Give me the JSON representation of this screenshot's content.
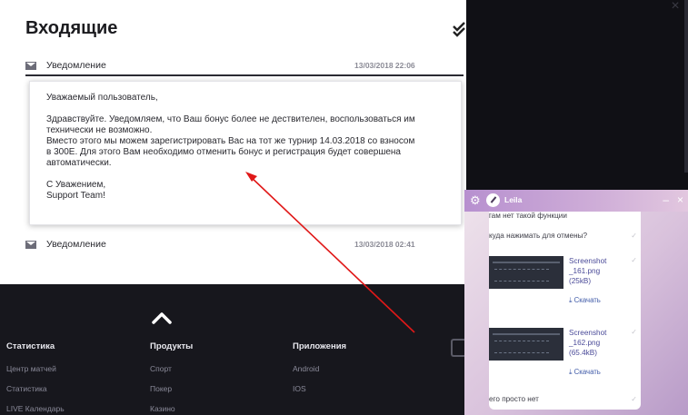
{
  "inbox": {
    "title": "Входящие",
    "mark_all_icon": "double-check-icon",
    "notifications": [
      {
        "label": "Уведомление",
        "date": "13/03/2018 22:06"
      },
      {
        "label": "Уведомление",
        "date": "13/03/2018 02:41"
      }
    ],
    "message": {
      "greeting": "Уважаемый пользователь,",
      "line1": "Здравствуйте. Уведомляем, что Ваш бонус более не дествителен, воспользоваться им",
      "line2": "технически не возможно.",
      "line3": "Вместо этого мы можем зарегистрировать Вас на тот же турнир 14.03.2018 со взносом",
      "line4": "в 300Е. Для этого Вам необходимо отменить бонус и регистрация будет совершена",
      "line5": "автоматически.",
      "signoff1": "С Уважением,",
      "signoff2": "Support Team!"
    }
  },
  "footer": {
    "scroll_top_icon": "chevron-up-icon",
    "columns": [
      {
        "head": "Статистика",
        "links": [
          "Центр матчей",
          "Статистика",
          "LIVE Календарь"
        ]
      },
      {
        "head": "Продукты",
        "links": [
          "Спорт",
          "Покер",
          "Казино"
        ]
      },
      {
        "head": "Приложения",
        "links": [
          "Android",
          "IOS"
        ]
      }
    ],
    "social_icon": "instagram-icon"
  },
  "overlay": {
    "close_label": "×"
  },
  "chat": {
    "agent_name": "Leila",
    "minimize_label": "–",
    "close_label": "×",
    "messages": [
      "там нет такой функции",
      "куда нажимать для отмены?"
    ],
    "attachments": [
      {
        "name_line1": "Screenshot",
        "name_line2": "_161.png",
        "size": "(25kB)",
        "download": "Скачать"
      },
      {
        "name_line1": "Screenshot",
        "name_line2": "_162.png",
        "size": "(65.4kB)",
        "download": "Скачать"
      }
    ],
    "last_message": "его просто нет"
  },
  "colors": {
    "accent_arrow": "#e01818",
    "footer_bg": "#17171d",
    "chat_header": "#b790cf"
  }
}
